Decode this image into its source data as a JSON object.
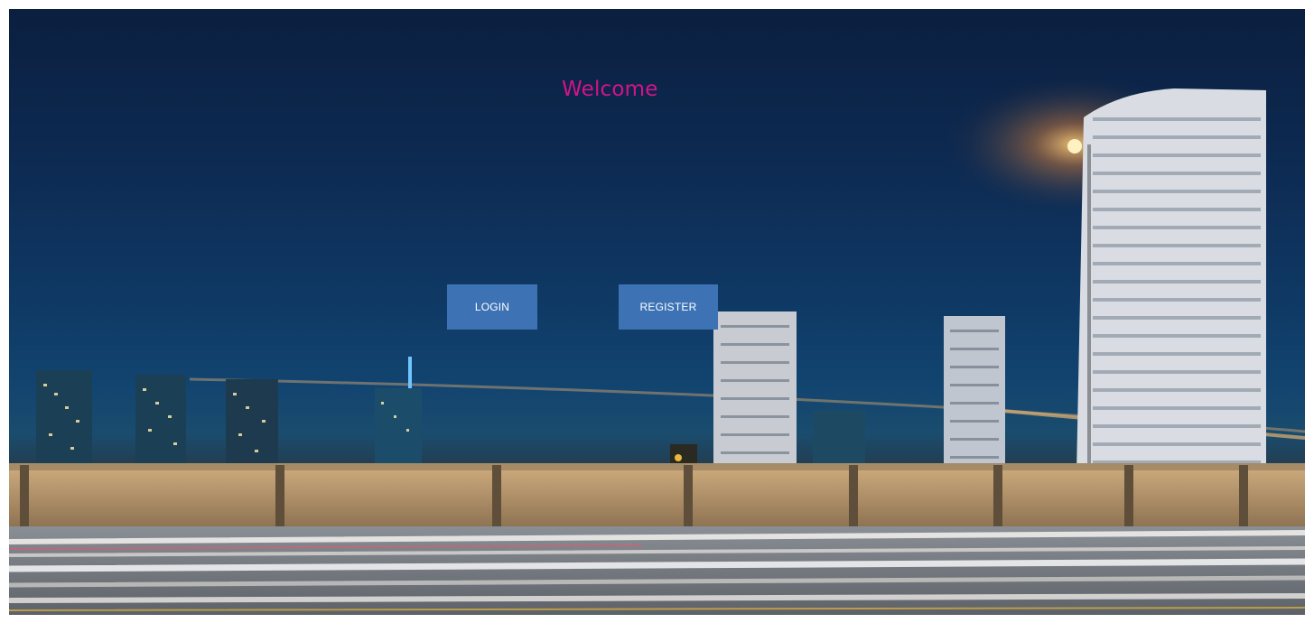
{
  "page": {
    "heading": "Welcome"
  },
  "actions": {
    "login_label": "LOGIN",
    "register_label": "REGISTER"
  },
  "colors": {
    "heading": "#d4138a",
    "button_bg": "#3d73b5",
    "button_text": "#ffffff",
    "sky_top": "#0b1f3f",
    "sky_bottom": "#124470"
  }
}
